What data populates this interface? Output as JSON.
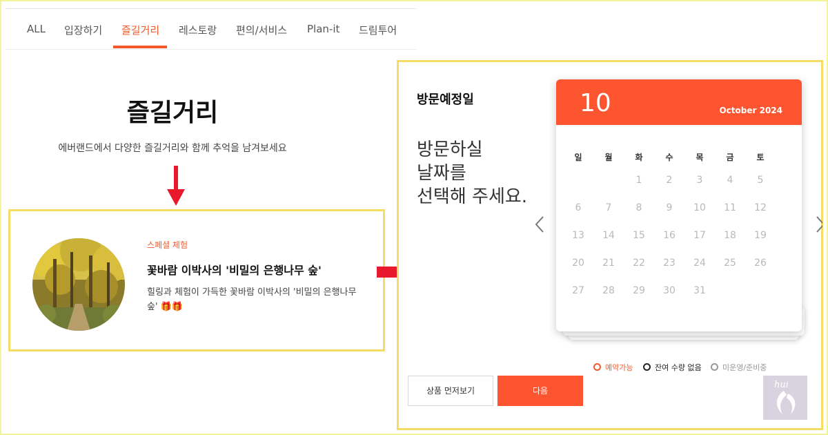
{
  "tabs": {
    "items": [
      "ALL",
      "입장하기",
      "즐길거리",
      "레스토랑",
      "편의/서비스",
      "Plan-it",
      "드림투어"
    ],
    "active": "즐길거리"
  },
  "section": {
    "title": "즐길거리",
    "description": "에버랜드에서 다양한 즐길거리와 함께 추억을 남겨보세요"
  },
  "card": {
    "tag": "스페셜 체험",
    "title": "꽃바람 이박사의 '비밀의 은행나무 숲'",
    "description": "힐링과 체험이 가득한 꽃바람 이박사의 '비밀의 은행나무 숲' 🎁🎁",
    "image": "ginkgo-forest-path-photo"
  },
  "booking": {
    "title": "방문예정일",
    "prompt": "방문하실\n날짜를\n선택해 주세요.",
    "calendar": {
      "selected_day": "10",
      "month_year": "October 2024",
      "weekdays": [
        "일",
        "월",
        "화",
        "수",
        "목",
        "금",
        "토"
      ],
      "weeks": [
        [
          "",
          "",
          "1",
          "2",
          "3",
          "4",
          "5"
        ],
        [
          "6",
          "7",
          "8",
          "9",
          "10",
          "11",
          "12"
        ],
        [
          "13",
          "14",
          "15",
          "16",
          "17",
          "18",
          "19"
        ],
        [
          "20",
          "21",
          "22",
          "23",
          "24",
          "25",
          "26"
        ],
        [
          "27",
          "28",
          "29",
          "30",
          "31",
          "",
          ""
        ]
      ]
    },
    "legend": [
      {
        "label": "예약가능",
        "color": "#f25a2b"
      },
      {
        "label": "잔여 수량 없음",
        "color": "#222222"
      },
      {
        "label": "미운영/준비중",
        "color": "#999999"
      }
    ],
    "preview_button": "상품 먼저보기",
    "next_button": "다음"
  },
  "watermark": {
    "text": "hui"
  },
  "colors": {
    "accent": "#fd5530",
    "highlight_border": "#f5dc62",
    "arrow": "#e8192c"
  },
  "icons": [
    "arrow-down-icon",
    "arrow-right-icon",
    "chevron-left-icon",
    "chevron-right-icon"
  ]
}
